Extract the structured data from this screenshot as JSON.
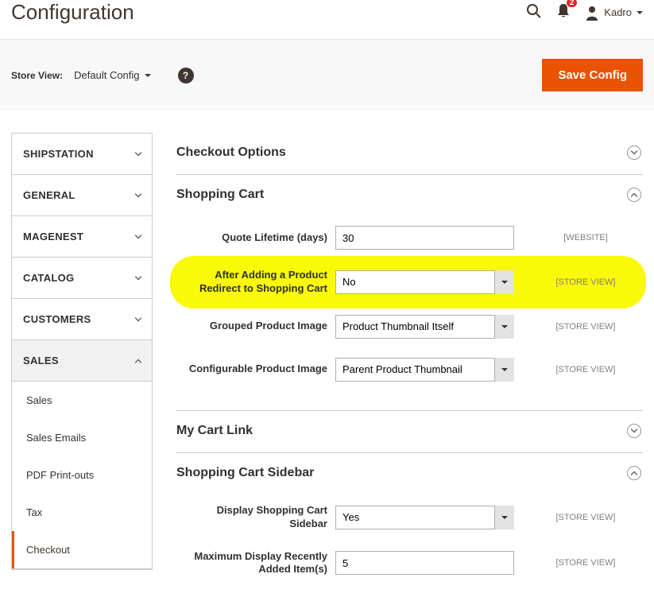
{
  "header": {
    "title": "Configuration",
    "notif_count": "2",
    "user_name": "Kadro"
  },
  "toolbar": {
    "store_view_label": "Store View:",
    "store_view_value": "Default Config",
    "save_label": "Save Config"
  },
  "sidebar": {
    "items": [
      {
        "label": "SHIPSTATION",
        "expanded": false
      },
      {
        "label": "GENERAL",
        "expanded": false
      },
      {
        "label": "MAGENEST",
        "expanded": false
      },
      {
        "label": "CATALOG",
        "expanded": false
      },
      {
        "label": "CUSTOMERS",
        "expanded": false
      },
      {
        "label": "SALES",
        "expanded": true
      }
    ],
    "sales_sub": [
      {
        "label": "Sales",
        "active": false
      },
      {
        "label": "Sales Emails",
        "active": false
      },
      {
        "label": "PDF Print-outs",
        "active": false
      },
      {
        "label": "Tax",
        "active": false
      },
      {
        "label": "Checkout",
        "active": true
      }
    ]
  },
  "sections": {
    "checkout_options": {
      "title": "Checkout Options",
      "expanded": false
    },
    "shopping_cart": {
      "title": "Shopping Cart",
      "expanded": true,
      "fields": {
        "quote_lifetime": {
          "label": "Quote Lifetime (days)",
          "value": "30",
          "scope": "[WEBSITE]"
        },
        "redirect": {
          "label": "After Adding a Product Redirect to Shopping Cart",
          "value": "No",
          "scope": "[STORE VIEW]"
        },
        "grouped_img": {
          "label": "Grouped Product Image",
          "value": "Product Thumbnail Itself",
          "scope": "[STORE VIEW]"
        },
        "configurable_img": {
          "label": "Configurable Product Image",
          "value": "Parent Product Thumbnail",
          "scope": "[STORE VIEW]"
        }
      }
    },
    "my_cart_link": {
      "title": "My Cart Link",
      "expanded": false
    },
    "sidebar_section": {
      "title": "Shopping Cart Sidebar",
      "expanded": true,
      "fields": {
        "display": {
          "label": "Display Shopping Cart Sidebar",
          "value": "Yes",
          "scope": "[STORE VIEW]"
        },
        "max_items": {
          "label": "Maximum Display Recently Added Item(s)",
          "value": "5",
          "scope": "[STORE VIEW]"
        }
      }
    }
  }
}
